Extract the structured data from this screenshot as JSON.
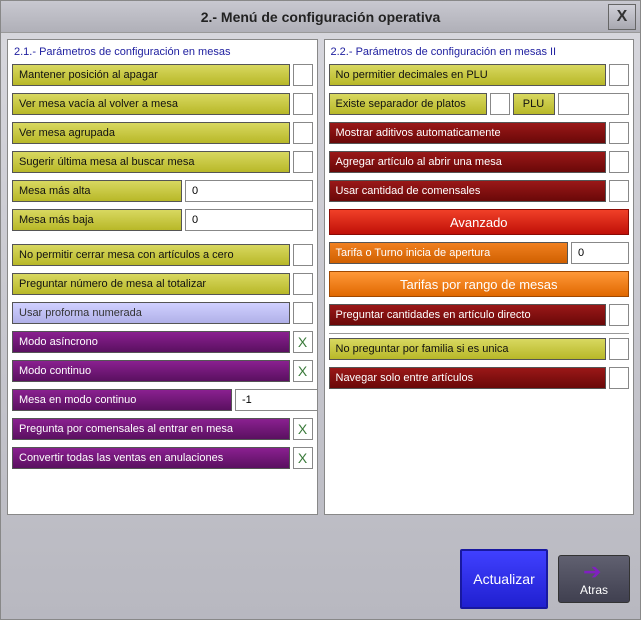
{
  "title": "2.- Menú de configuración operativa",
  "close": "X",
  "left": {
    "title": "2.1.- Parámetros de configuración en mesas",
    "items": [
      {
        "label": "Mantener posición al apagar",
        "style": "olive",
        "chk": ""
      },
      {
        "label": "Ver mesa vacía al volver a mesa",
        "style": "olive",
        "chk": ""
      },
      {
        "label": "Ver mesa agrupada",
        "style": "olive",
        "chk": ""
      },
      {
        "label": "Sugerir última mesa al buscar mesa",
        "style": "olive",
        "chk": ""
      }
    ],
    "mesa_alta": {
      "label": "Mesa más alta",
      "value": "0"
    },
    "mesa_baja": {
      "label": "Mesa más baja",
      "value": "0"
    },
    "group2": [
      {
        "label": "No permitir cerrar mesa con artículos a cero",
        "style": "olive",
        "chk": ""
      },
      {
        "label": "Preguntar número de mesa al totalizar",
        "style": "olive",
        "chk": ""
      },
      {
        "label": "Usar proforma numerada",
        "style": "lilac",
        "chk": ""
      },
      {
        "label": "Modo asíncrono",
        "style": "purple",
        "chk": "X"
      },
      {
        "label": "Modo continuo",
        "style": "purple",
        "chk": "X"
      }
    ],
    "mesa_cont": {
      "label": "Mesa en modo continuo",
      "value": "-1"
    },
    "group3": [
      {
        "label": "Pregunta por comensales al entrar en mesa",
        "style": "purple",
        "chk": "X"
      },
      {
        "label": "Convertir todas las ventas en anulaciones",
        "style": "purple",
        "chk": "X"
      }
    ]
  },
  "right": {
    "title": "2.2.- Parámetros de configuración en mesas II",
    "r1": [
      {
        "label": "No permitier decimales en PLU",
        "style": "olive",
        "chk": ""
      }
    ],
    "sep": {
      "label": "Existe separador de platos",
      "btn": "PLU",
      "value": ""
    },
    "r2": [
      {
        "label": "Mostrar aditivos automaticamente",
        "style": "red",
        "chk": ""
      },
      {
        "label": "Agregar artículo al abrir una mesa",
        "style": "red",
        "chk": ""
      },
      {
        "label": "Usar cantidad de comensales",
        "style": "red",
        "chk": ""
      }
    ],
    "avanzado": "Avanzado",
    "tarifa": {
      "label": "Tarifa o Turno inicia de apertura",
      "value": "0"
    },
    "tarifas_btn": "Tarifas por rango de mesas",
    "r3": [
      {
        "label": "Preguntar cantidades en artículo directo",
        "style": "red",
        "chk": ""
      }
    ],
    "r4": [
      {
        "label": "No preguntar por familia si es unica",
        "style": "olive",
        "chk": ""
      },
      {
        "label": "Navegar solo entre artículos",
        "style": "red",
        "chk": ""
      }
    ]
  },
  "footer": {
    "update": "Actualizar",
    "back": "Atras"
  }
}
